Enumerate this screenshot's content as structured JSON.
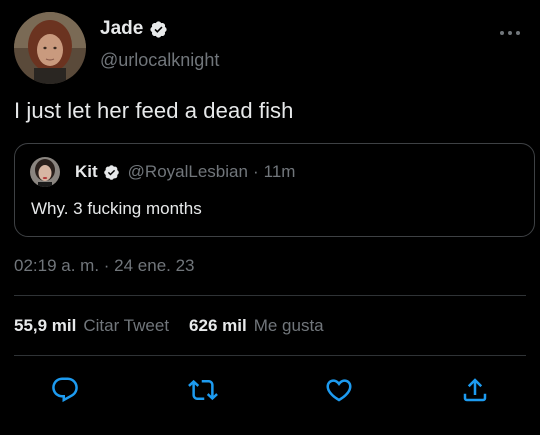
{
  "author": {
    "name": "Jade",
    "handle": "@urlocalknight",
    "avatar_icon": "avatar-photo-icon",
    "verified_icon": "verified-badge-icon"
  },
  "tweet": {
    "text": "I just let her feed a dead fish"
  },
  "quoted_tweet": {
    "name": "Kit",
    "handle": "@RoyalLesbian",
    "separator": "·",
    "time_ago": "11m",
    "text": "Why. 3 fucking months"
  },
  "meta": {
    "timestamp": "02:19 a. m. · 24 ene. 23"
  },
  "stats": {
    "quotes_count": "55,9 mil",
    "quotes_label": "Citar Tweet",
    "likes_count": "626 mil",
    "likes_label": "Me gusta"
  },
  "actions": {
    "reply_icon": "reply-icon",
    "retweet_icon": "retweet-icon",
    "like_icon": "heart-icon",
    "share_icon": "share-icon",
    "more_icon": "more-options-icon"
  },
  "colors": {
    "background": "#000000",
    "text_primary": "#e7e9ea",
    "text_secondary": "#71767b",
    "border": "#2f3336",
    "icon": "#1d9bf0"
  }
}
